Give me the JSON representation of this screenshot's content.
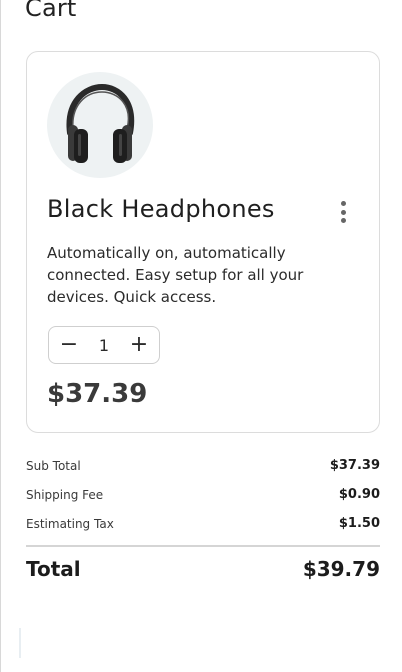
{
  "header": {
    "title": "Cart"
  },
  "item": {
    "image_icon": "headphones-icon",
    "name": "Black Headphones",
    "description": "Automatically on, automatically connected. Easy setup for all your devices. Quick access.",
    "quantity": "1",
    "decrement_label": "−",
    "increment_label": "+",
    "price": "$37.39",
    "menu_icon": "kebab-menu-icon"
  },
  "summary": {
    "subtotal_label": "Sub Total",
    "subtotal_value": "$37.39",
    "shipping_label": "Shipping Fee",
    "shipping_value": "$0.90",
    "tax_label": "Estimating Tax",
    "tax_value": "$1.50",
    "total_label": "Total",
    "total_value": "$39.79"
  }
}
